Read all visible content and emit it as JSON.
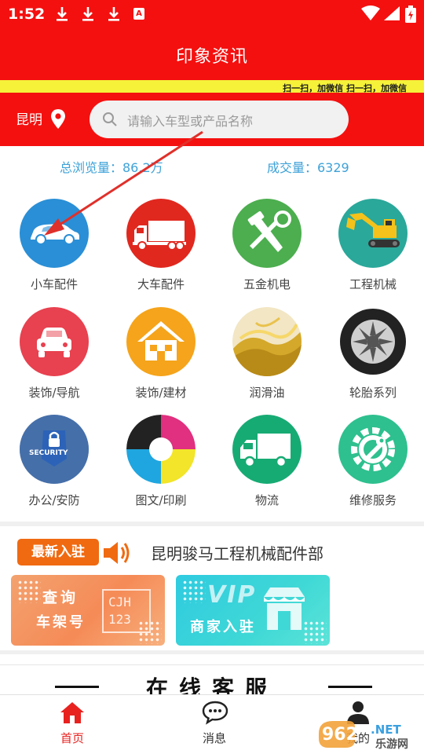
{
  "status_bar": {
    "time": "1:52",
    "a_badge": "A"
  },
  "header": {
    "title": "印象资讯",
    "marquee": "扫一扫，加微信   扫一扫，加微信"
  },
  "search": {
    "city": "昆明",
    "placeholder": "请输入车型或产品名称"
  },
  "stats": {
    "browse": "总浏览量：86.2万",
    "deals": "成交量：6329"
  },
  "categories": [
    {
      "label": "小车配件",
      "icon": "car-icon",
      "color": "#2a8fd6"
    },
    {
      "label": "大车配件",
      "icon": "truck-icon",
      "color": "#e0281f"
    },
    {
      "label": "五金机电",
      "icon": "tools-icon",
      "color": "#4cae4f"
    },
    {
      "label": "工程机械",
      "icon": "excavator-icon",
      "color": "#2aa89a"
    },
    {
      "label": "装饰/导航",
      "icon": "car-front-icon",
      "color": "#e8414f"
    },
    {
      "label": "装饰/建材",
      "icon": "house-icon",
      "color": "#f5a41b"
    },
    {
      "label": "润滑油",
      "icon": "oil-splash-icon",
      "color": "#d4a82a"
    },
    {
      "label": "轮胎系列",
      "icon": "tire-icon",
      "color": "#222222"
    },
    {
      "label": "办公/安防",
      "icon": "security-lock-icon",
      "color": "#1f4a8a"
    },
    {
      "label": "图文/印刷",
      "icon": "print-color-icon",
      "color": "#e0307f"
    },
    {
      "label": "物流",
      "icon": "delivery-truck-icon",
      "color": "#17ab74"
    },
    {
      "label": "维修服务",
      "icon": "repair-gear-icon",
      "color": "#2ec08f"
    }
  ],
  "security_text": "SECURITY",
  "news": {
    "badge": "最新入驻",
    "text": "昆明骏马工程机械配件部"
  },
  "banners": {
    "query_line1": "查询",
    "query_line2": "车架号",
    "cjh_line1": "CJH",
    "cjh_line2": "123",
    "vip_word": "VIP",
    "vip_line": "商家入驻"
  },
  "service": {
    "title": "在线客服"
  },
  "nav": [
    {
      "label": "首页",
      "icon": "home-icon",
      "active": true
    },
    {
      "label": "消息",
      "icon": "message-icon",
      "active": false
    },
    {
      "label": "我的",
      "icon": "user-icon",
      "active": false
    }
  ],
  "watermark": {
    "number": "962",
    "suffix": ".NET",
    "site": "乐游网"
  },
  "colors": {
    "brand_red": "#f4100f",
    "stat_blue": "#3ea2d8",
    "news_orange": "#f06a11",
    "nav_active": "#e8221f"
  }
}
